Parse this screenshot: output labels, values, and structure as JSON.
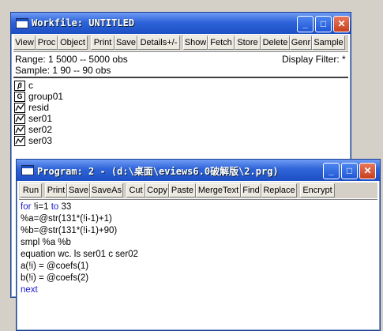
{
  "workfile": {
    "title": "Workfile: UNTITLED",
    "toolbar": [
      "View",
      "Proc",
      "Object",
      "Print",
      "Save",
      "Details+/-",
      "Show",
      "Fetch",
      "Store",
      "Delete",
      "Genr",
      "Sample"
    ],
    "range_text": "Range:  1 5000   --   5000 obs",
    "filter_text": "Display Filter: *",
    "sample_text": "Sample: 1 90   --   90 obs",
    "objects": [
      {
        "name": "c",
        "icon": "coefficient-vector-icon"
      },
      {
        "name": "group01",
        "icon": "group-icon"
      },
      {
        "name": "resid",
        "icon": "series-icon"
      },
      {
        "name": "ser01",
        "icon": "series-icon"
      },
      {
        "name": "ser02",
        "icon": "series-icon"
      },
      {
        "name": "ser03",
        "icon": "series-icon"
      }
    ]
  },
  "program": {
    "title": "Program: 2 - (d:\\桌面\\eviews6.0破解版\\2.prg)",
    "toolbar": [
      "Run",
      "Print",
      "Save",
      "SaveAs",
      "Cut",
      "Copy",
      "Paste",
      "MergeText",
      "Find",
      "Replace",
      "Encrypt"
    ],
    "lines": [
      {
        "kw": "for",
        "rest": " !i=1 ",
        "kw2": "to",
        "rest2": " 33"
      },
      {
        "kw": "",
        "rest": "%a=@str(131*(!i-1)+1)",
        "kw2": "",
        "rest2": ""
      },
      {
        "kw": "",
        "rest": "%b=@str(131*(!i-1)+90)",
        "kw2": "",
        "rest2": ""
      },
      {
        "kw": "",
        "rest": "smpl %a %b",
        "kw2": "",
        "rest2": ""
      },
      {
        "kw": "",
        "rest": "equation wc. ls ser01 c ser02",
        "kw2": "",
        "rest2": ""
      },
      {
        "kw": "",
        "rest": "a(!i) = @coefs(1)",
        "kw2": "",
        "rest2": ""
      },
      {
        "kw": "",
        "rest": "b(!i) = @coefs(2)",
        "kw2": "",
        "rest2": ""
      },
      {
        "kw": "next",
        "rest": "",
        "kw2": "",
        "rest2": ""
      }
    ]
  },
  "colors": {
    "titlebar": "#2e63d9",
    "keyword": "#1a1ad0",
    "close": "#c8401e"
  }
}
